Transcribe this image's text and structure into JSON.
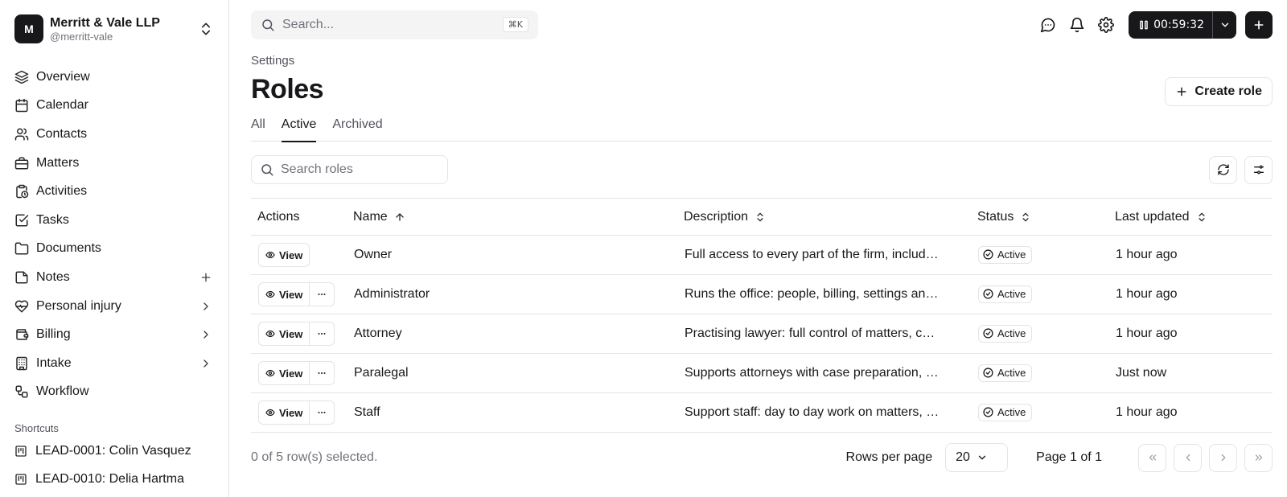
{
  "org": {
    "initial": "M",
    "name": "Merritt & Vale LLP",
    "handle": "@merritt-vale"
  },
  "nav": [
    {
      "label": "Overview",
      "icon": "layers-icon"
    },
    {
      "label": "Calendar",
      "icon": "calendar-icon"
    },
    {
      "label": "Contacts",
      "icon": "users-icon"
    },
    {
      "label": "Matters",
      "icon": "briefcase-icon"
    },
    {
      "label": "Activities",
      "icon": "clipboard-clock-icon"
    },
    {
      "label": "Tasks",
      "icon": "check-square-icon"
    },
    {
      "label": "Documents",
      "icon": "folder-icon"
    },
    {
      "label": "Notes",
      "icon": "note-icon",
      "trailing": "plus-icon"
    },
    {
      "label": "Personal injury",
      "icon": "heart-pulse-icon",
      "trailing": "chevron-right-icon"
    },
    {
      "label": "Billing",
      "icon": "wallet-icon",
      "trailing": "chevron-right-icon"
    },
    {
      "label": "Intake",
      "icon": "building-icon",
      "trailing": "chevron-right-icon"
    },
    {
      "label": "Workflow",
      "icon": "workflow-icon"
    }
  ],
  "shortcuts": {
    "label": "Shortcuts",
    "items": [
      {
        "label": "LEAD-0001: Colin Vasquez"
      },
      {
        "label": "LEAD-0010: Delia Hartma"
      }
    ]
  },
  "topbar": {
    "search_placeholder": "Search...",
    "shortcut_key": "⌘K",
    "timer": "00:59:32"
  },
  "page": {
    "breadcrumb": "Settings",
    "title": "Roles",
    "create_label": "Create role"
  },
  "tabs": [
    {
      "label": "All",
      "active": false
    },
    {
      "label": "Active",
      "active": true
    },
    {
      "label": "Archived",
      "active": false
    }
  ],
  "table": {
    "search_placeholder": "Search roles",
    "columns": [
      "Actions",
      "Name",
      "Description",
      "Status",
      "Last updated"
    ],
    "view_label": "View",
    "rows": [
      {
        "name": "Owner",
        "description": "Full access to every part of the firm, includ…",
        "status": "Active",
        "updated": "1 hour ago",
        "has_more": false
      },
      {
        "name": "Administrator",
        "description": "Runs the office: people, billing, settings an…",
        "status": "Active",
        "updated": "1 hour ago",
        "has_more": true
      },
      {
        "name": "Attorney",
        "description": "Practising lawyer: full control of matters, c…",
        "status": "Active",
        "updated": "1 hour ago",
        "has_more": true
      },
      {
        "name": "Paralegal",
        "description": "Supports attorneys with case preparation, …",
        "status": "Active",
        "updated": "Just now",
        "has_more": true
      },
      {
        "name": "Staff",
        "description": "Support staff: day to day work on matters, …",
        "status": "Active",
        "updated": "1 hour ago",
        "has_more": true
      }
    ]
  },
  "footer": {
    "selection": "0 of 5 row(s) selected.",
    "rows_per_page_label": "Rows per page",
    "rows_per_page": "20",
    "page_info": "Page 1 of 1"
  }
}
